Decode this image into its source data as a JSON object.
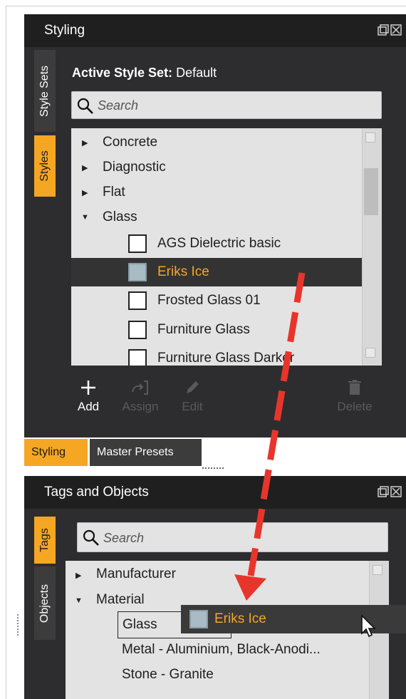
{
  "styling_panel": {
    "title": "Styling",
    "side_tabs": [
      {
        "label": "Style Sets",
        "active": false
      },
      {
        "label": "Styles",
        "active": true
      }
    ],
    "active_style_set_label": "Active Style Set:",
    "active_style_set_value": "Default",
    "search_placeholder": "Search",
    "tree": [
      {
        "label": "Concrete",
        "type": "folder",
        "expanded": false
      },
      {
        "label": "Diagnostic",
        "type": "folder",
        "expanded": false
      },
      {
        "label": "Flat",
        "type": "folder",
        "expanded": false
      },
      {
        "label": "Glass",
        "type": "folder",
        "expanded": true
      },
      {
        "label": "AGS Dielectric basic",
        "type": "style",
        "selected": false
      },
      {
        "label": "Eriks Ice",
        "type": "style",
        "selected": true
      },
      {
        "label": "Frosted Glass 01",
        "type": "style",
        "selected": false
      },
      {
        "label": "Furniture Glass",
        "type": "style",
        "selected": false
      },
      {
        "label": "Furniture Glass Darker",
        "type": "style",
        "selected": false
      }
    ],
    "toolbar": {
      "add": "Add",
      "assign": "Assign",
      "edit": "Edit",
      "delete": "Delete"
    }
  },
  "bottom_tabs": [
    {
      "label": "Styling",
      "active": true
    },
    {
      "label": "Master Presets",
      "active": false
    }
  ],
  "tags_panel": {
    "title": "Tags and Objects",
    "side_tabs": [
      {
        "label": "Tags",
        "active": true
      },
      {
        "label": "Objects",
        "active": false
      }
    ],
    "search_placeholder": "Search",
    "tree": [
      {
        "label": "Manufacturer",
        "type": "folder",
        "expanded": false
      },
      {
        "label": "Material",
        "type": "folder",
        "expanded": true
      },
      {
        "label": "Glass",
        "type": "tag",
        "highlighted": true
      },
      {
        "label": "Metal - Aluminium, Black-Anodi...",
        "type": "tag"
      },
      {
        "label": "Stone - Granite",
        "type": "tag"
      }
    ]
  },
  "drag_preview": {
    "label": "Eriks Ice"
  },
  "colors": {
    "accent": "#f5a623",
    "panel_bg": "#2d2d30",
    "header_bg": "#1f1f1f",
    "list_bg": "#e3e3e3",
    "arrow": "#e8352c",
    "swatch_selected": "#a9bcc6"
  }
}
